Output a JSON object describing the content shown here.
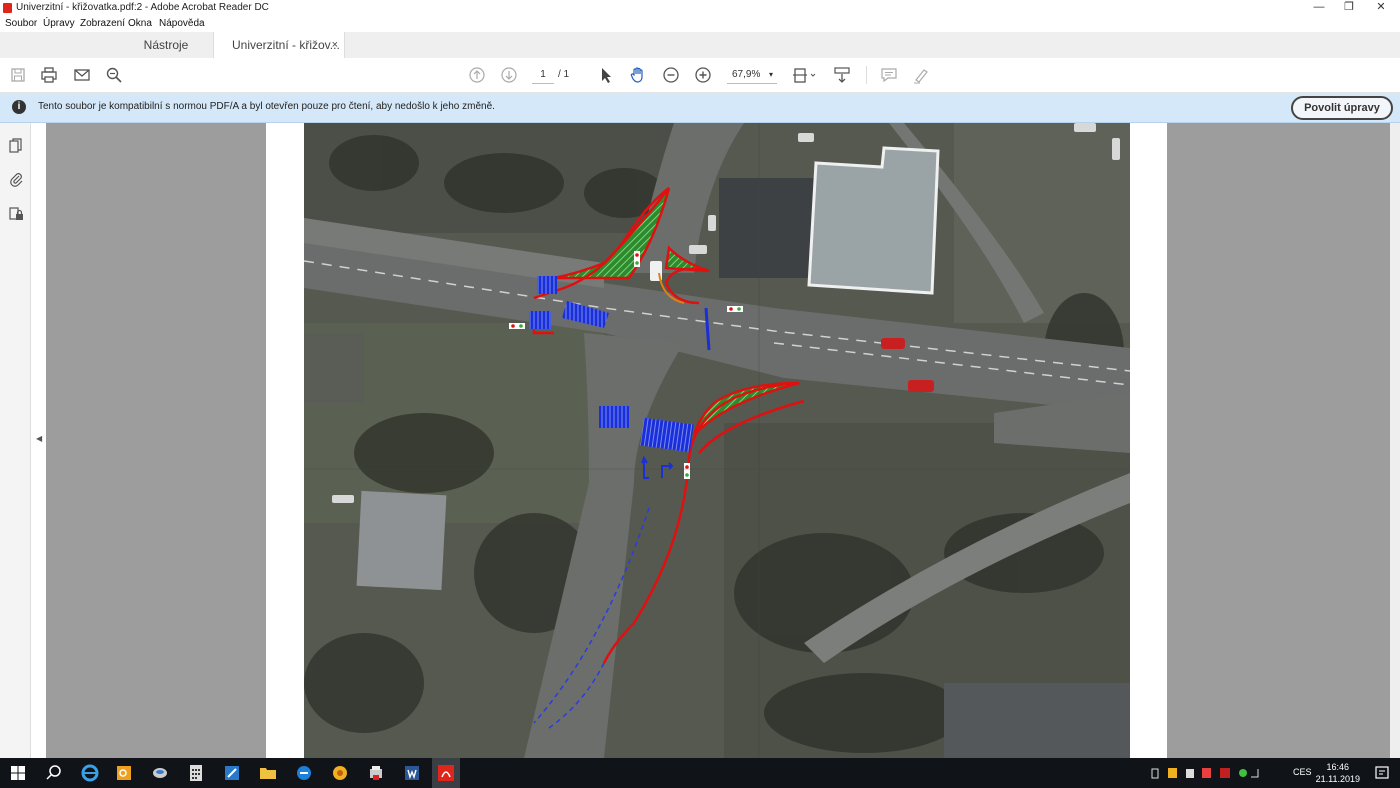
{
  "window": {
    "title": "Univerzitní - křižovatka.pdf:2 - Adobe Acrobat Reader DC",
    "minimize": "—",
    "restore": "❐",
    "close": "✕"
  },
  "menu": [
    "Soubor",
    "Úpravy",
    "Zobrazení",
    "Okna",
    "Nápověda"
  ],
  "tabs": {
    "tools": "Nástroje",
    "document": "Univerzitní - křižov...",
    "close": "×"
  },
  "toolbar": {
    "page_current": "1",
    "page_total": "/ 1",
    "zoom": "67,9%",
    "zoom_caret": "▾"
  },
  "infobar": {
    "icon": "i",
    "message": "Tento soubor je kompatibilní s normou PDF/A a byl otevřen pouze pro čtení, aby nedošlo k jeho změně.",
    "button": "Povolit úpravy"
  },
  "taskbar": {
    "lang": "CES",
    "time": "16:46",
    "date": "21.11.2019"
  },
  "colors": {
    "infobar_bg": "#d4e8f9",
    "doc_bg": "#9d9d9d",
    "taskbar_bg": "#101418",
    "markup_red": "#e01010",
    "markup_blue": "#1a2fd8",
    "markup_green": "#3aa83a"
  }
}
